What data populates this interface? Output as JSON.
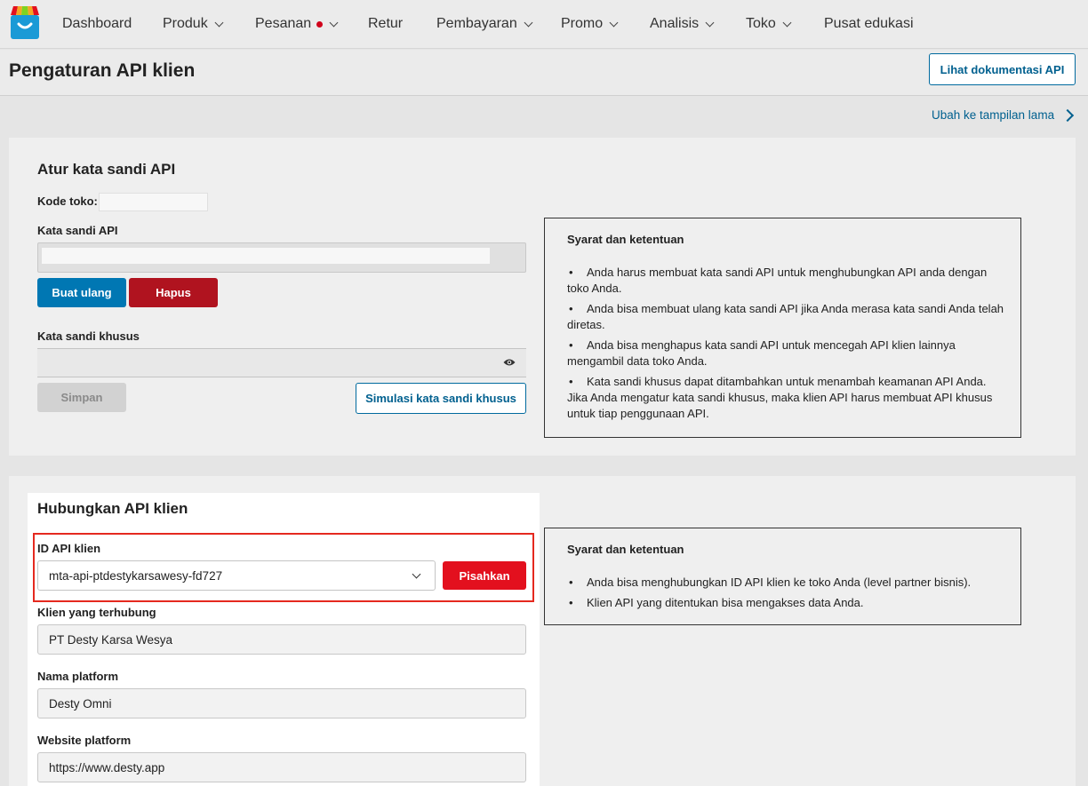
{
  "nav": {
    "items": [
      {
        "label": "Dashboard",
        "has_chevron": false
      },
      {
        "label": "Produk",
        "has_chevron": true
      },
      {
        "label": "Pesanan",
        "has_chevron": true,
        "has_dot": true
      },
      {
        "label": "Retur",
        "has_chevron": false
      },
      {
        "label": "Pembayaran",
        "has_chevron": true
      },
      {
        "label": "Promo",
        "has_chevron": true
      },
      {
        "label": "Analisis",
        "has_chevron": true
      },
      {
        "label": "Toko",
        "has_chevron": true
      },
      {
        "label": "Pusat edukasi",
        "has_chevron": false
      }
    ],
    "logo_icon": "shop-bag-icon"
  },
  "header": {
    "title": "Pengaturan API klien",
    "doc_button": "Lihat dokumentasi API"
  },
  "old_view_link": "Ubah ke tampilan lama",
  "password_section": {
    "title": "Atur kata sandi API",
    "store_code_label": "Kode toko:",
    "store_code_value": "",
    "api_password_label": "Kata sandi API",
    "api_password_value": "",
    "regenerate_button": "Buat ulang",
    "delete_button": "Hapus",
    "custom_password_label": "Kata sandi khusus",
    "custom_password_value": "",
    "save_button": "Simpan",
    "simulate_button": "Simulasi kata sandi khusus",
    "terms": {
      "title": "Syarat dan ketentuan",
      "items": [
        "Anda harus membuat kata sandi API untuk menghubungkan API anda dengan toko Anda.",
        "Anda bisa membuat ulang kata sandi API jika Anda merasa kata sandi Anda telah diretas.",
        "Anda bisa menghapus kata sandi API untuk mencegah API klien lainnya mengambil data toko Anda.",
        "Kata sandi khusus dapat ditambahkan untuk menambah keamanan API Anda. Jika Anda mengatur kata sandi khusus, maka klien API harus membuat API khusus untuk tiap penggunaan API."
      ]
    }
  },
  "connect_section": {
    "title": "Hubungkan API klien",
    "client_id_label": "ID API klien",
    "client_id_value": "mta-api-ptdestykarsawesy-fd727",
    "detach_button": "Pisahkan",
    "connected_client_label": "Klien yang terhubung",
    "connected_client_value": "PT Desty Karsa Wesya",
    "platform_name_label": "Nama platform",
    "platform_name_value": "Desty Omni",
    "platform_website_label": "Website platform",
    "platform_website_value": "https://www.desty.app",
    "terms": {
      "title": "Syarat dan ketentuan",
      "items": [
        "Anda bisa menghubungkan ID API klien ke toko Anda (level partner bisnis).",
        "Klien API yang ditentukan bisa mengakses data Anda."
      ]
    }
  },
  "colors": {
    "primary_blue": "#0077b3",
    "danger_red": "#e3101e",
    "dark_red": "#b0131f",
    "highlight_frame": "#e5291f"
  }
}
